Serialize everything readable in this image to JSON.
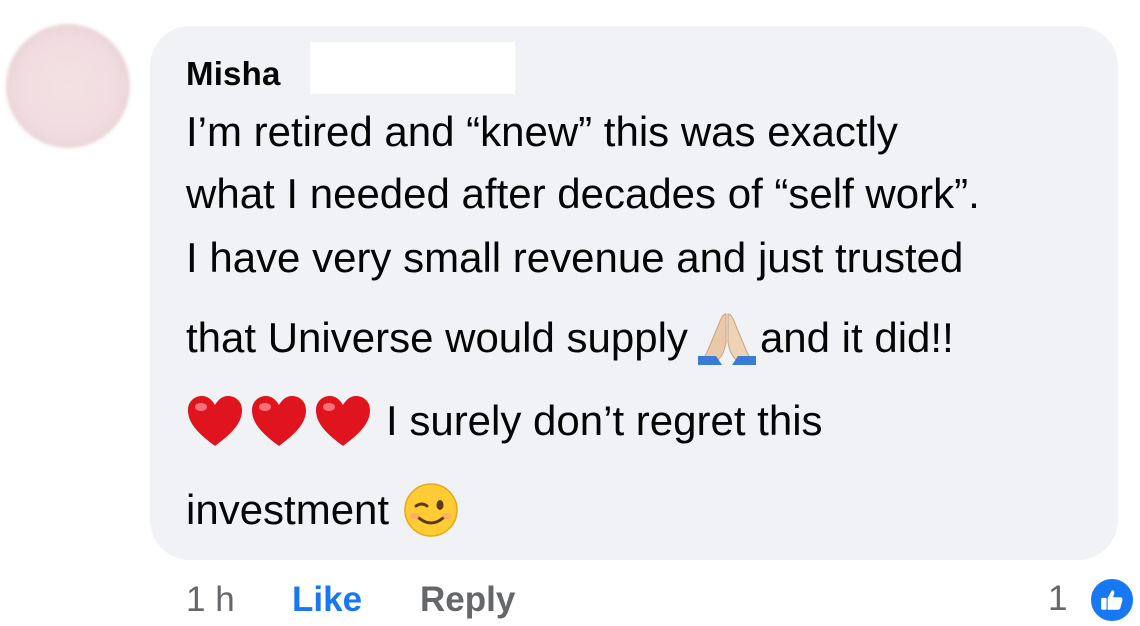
{
  "comment": {
    "author": "Misha",
    "lines": [
      "I’m retired and “knew” this was exactly",
      "what I needed after decades of “self work”.",
      "I have very small revenue and just trusted",
      "that Universe would supply",
      "and it did!!",
      "I surely don’t regret this",
      "investment"
    ],
    "emojis": [
      "folded-hands",
      "red-heart",
      "red-heart",
      "red-heart",
      "winking-face"
    ]
  },
  "actions": {
    "time": "1 h",
    "like_label": "Like",
    "reply_label": "Reply"
  },
  "reactions": {
    "count": "1",
    "type": "like-icon"
  },
  "colors": {
    "bubble": "#f0f2f5",
    "text": "#050505",
    "secondary": "#65676b",
    "accent": "#1877f2"
  }
}
